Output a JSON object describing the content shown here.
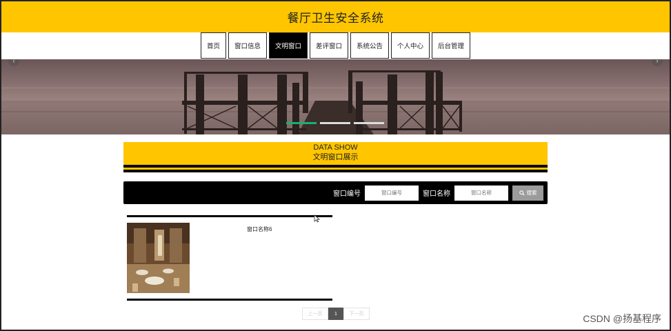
{
  "header": {
    "title": "餐厅卫生安全系统"
  },
  "nav": {
    "items": [
      {
        "label": "首页"
      },
      {
        "label": "窗口信息"
      },
      {
        "label": "文明窗口"
      },
      {
        "label": "差评窗口"
      },
      {
        "label": "系统公告"
      },
      {
        "label": "个人中心"
      },
      {
        "label": "后台管理"
      }
    ],
    "active_index": 2
  },
  "banner": {
    "slide_count": 3,
    "active_slide": 1
  },
  "section": {
    "title_en": "DATA SHOW",
    "title_cn": "文明窗口展示"
  },
  "search": {
    "field1_label": "窗口编号",
    "field1_placeholder": "窗口编号",
    "field2_label": "窗口名称",
    "field2_placeholder": "窗口名称",
    "button_label": "搜索"
  },
  "cards": [
    {
      "name": "窗口名称6"
    }
  ],
  "pagination": {
    "prev": "上一页",
    "current": "1",
    "next": "下一页"
  },
  "watermark": "CSDN @扬基程序",
  "colors": {
    "accent": "#ffc600",
    "dark": "#000000",
    "active_dot": "#18b16b"
  }
}
